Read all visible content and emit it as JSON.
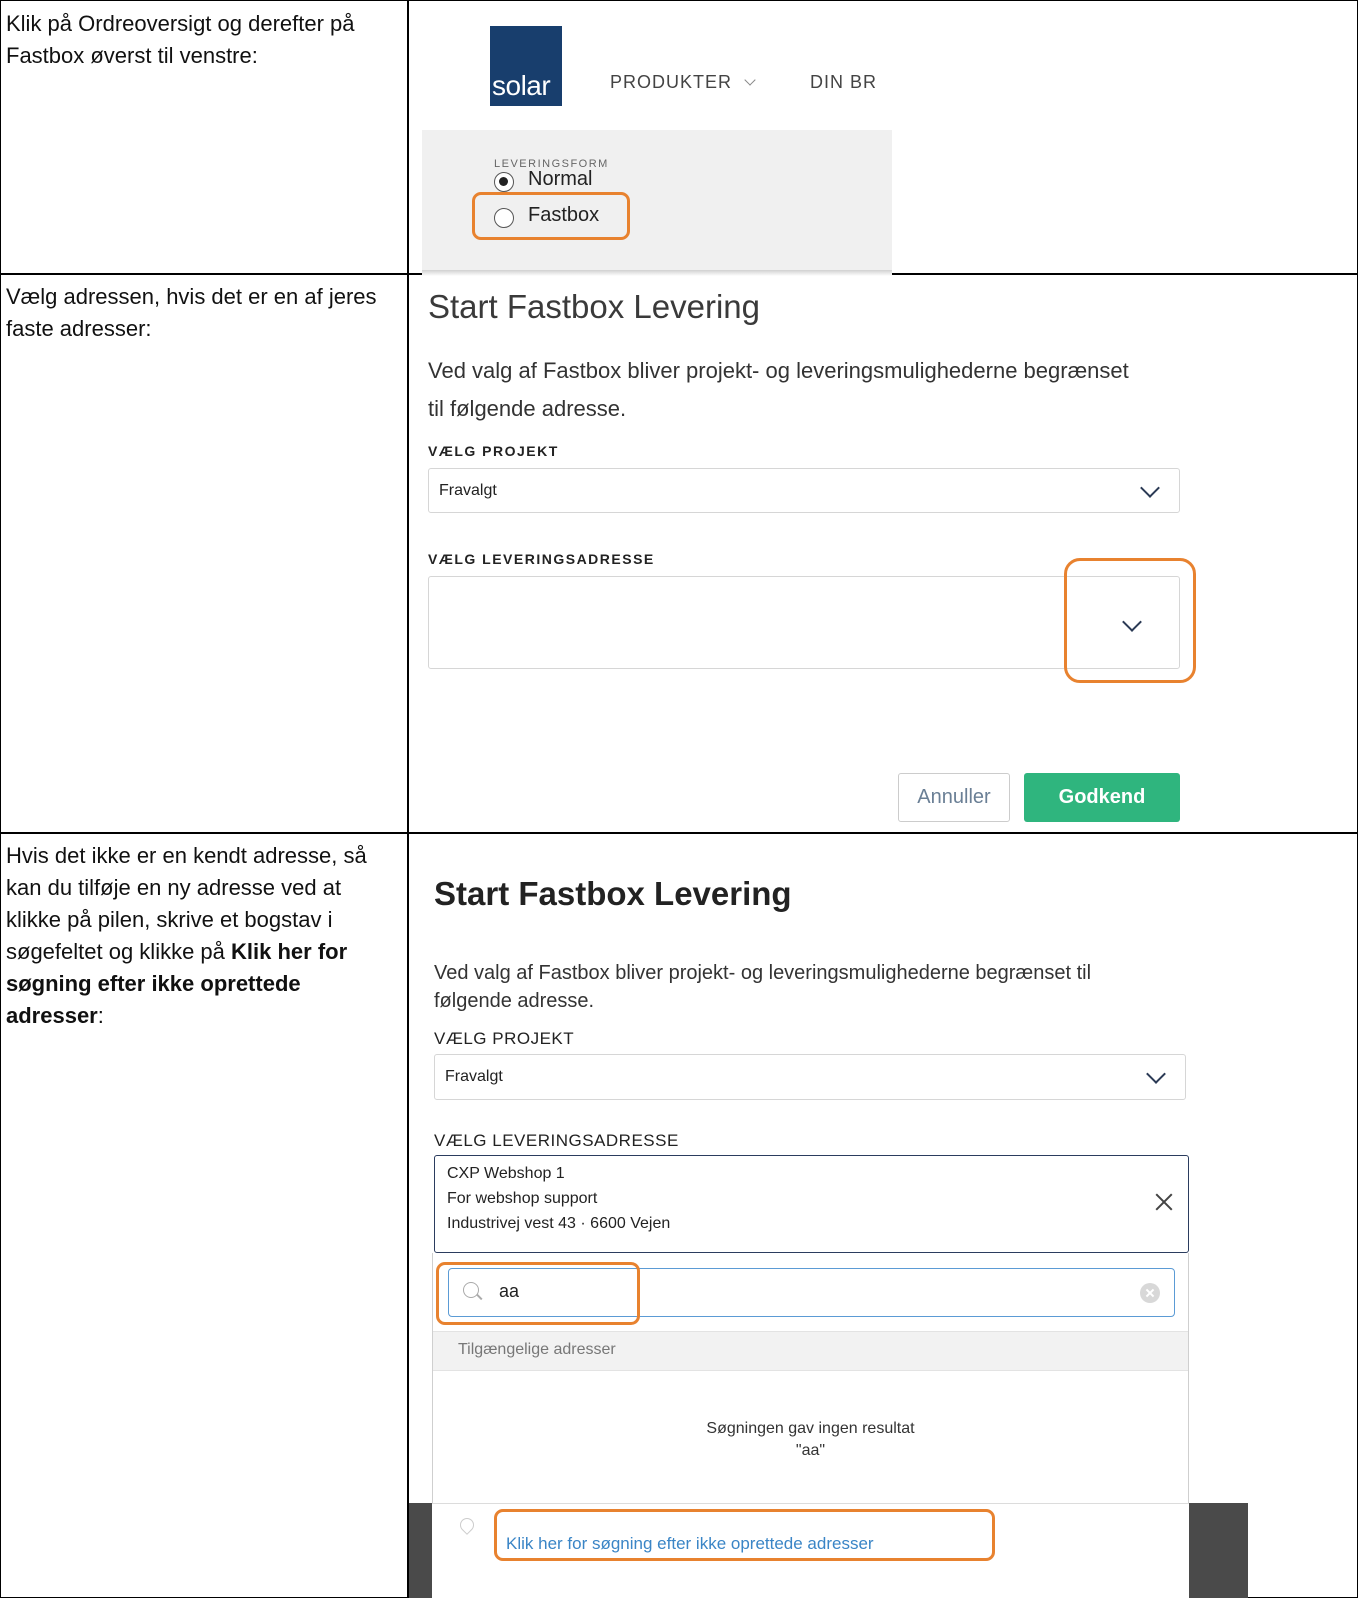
{
  "rows": [
    {
      "instruction": "Klik på Ordreoversigt og derefter på Fastbox øverst til venstre:",
      "screenshot": {
        "logo_text": "solar",
        "nav_items": [
          "PRODUKTER",
          "DIN BR"
        ],
        "delivery_label": "LEVERINGSFORM",
        "options": [
          {
            "label": "Normal",
            "checked": true
          },
          {
            "label": "Fastbox",
            "checked": false
          }
        ]
      }
    },
    {
      "instruction": "Vælg adressen, hvis det er en af jeres faste adresser:",
      "modal": {
        "title": "Start Fastbox Levering",
        "description": "Ved valg af Fastbox bliver projekt- og leveringsmulighederne begrænset til følgende adresse.",
        "project_label": "VÆLG PROJEKT",
        "project_value": "Fravalgt",
        "address_label": "VÆLG LEVERINGSADRESSE",
        "address_value": "",
        "cancel_label": "Annuller",
        "ok_label": "Godkend"
      }
    },
    {
      "instruction_parts": [
        {
          "text": "Hvis det ikke er en kendt adresse, så kan du tilføje en ny adresse ved at klikke på pilen, skrive et bogstav i søgefeltet og klikke på ",
          "bold": false
        },
        {
          "text": "Klik her for søgning efter ikke oprettede adresser",
          "bold": true
        },
        {
          "text": ":",
          "bold": false
        }
      ],
      "modal": {
        "title": "Start Fastbox Levering",
        "description": "Ved valg af Fastbox bliver projekt- og leveringsmulighederne begrænset til følgende adresse.",
        "project_label": "VÆLG PROJEKT",
        "project_value": "Fravalgt",
        "address_label": "VÆLG LEVERINGSADRESSE",
        "selected_address": [
          "CXP Webshop 1",
          "For webshop support",
          "Industrivej vest 43  · 6600 Vejen"
        ],
        "search_value": "aa",
        "available_header": "Tilgængelige adresser",
        "no_result_lines": [
          "Søgningen gav ingen resultat",
          "\"aa\""
        ],
        "link_text": "Klik her for søgning efter ikke oprettede adresser"
      }
    }
  ],
  "colors": {
    "highlight": "#e8822f",
    "approve_button": "#2fb57e",
    "logo_bg": "#183e6d",
    "link": "#3a85c6"
  }
}
